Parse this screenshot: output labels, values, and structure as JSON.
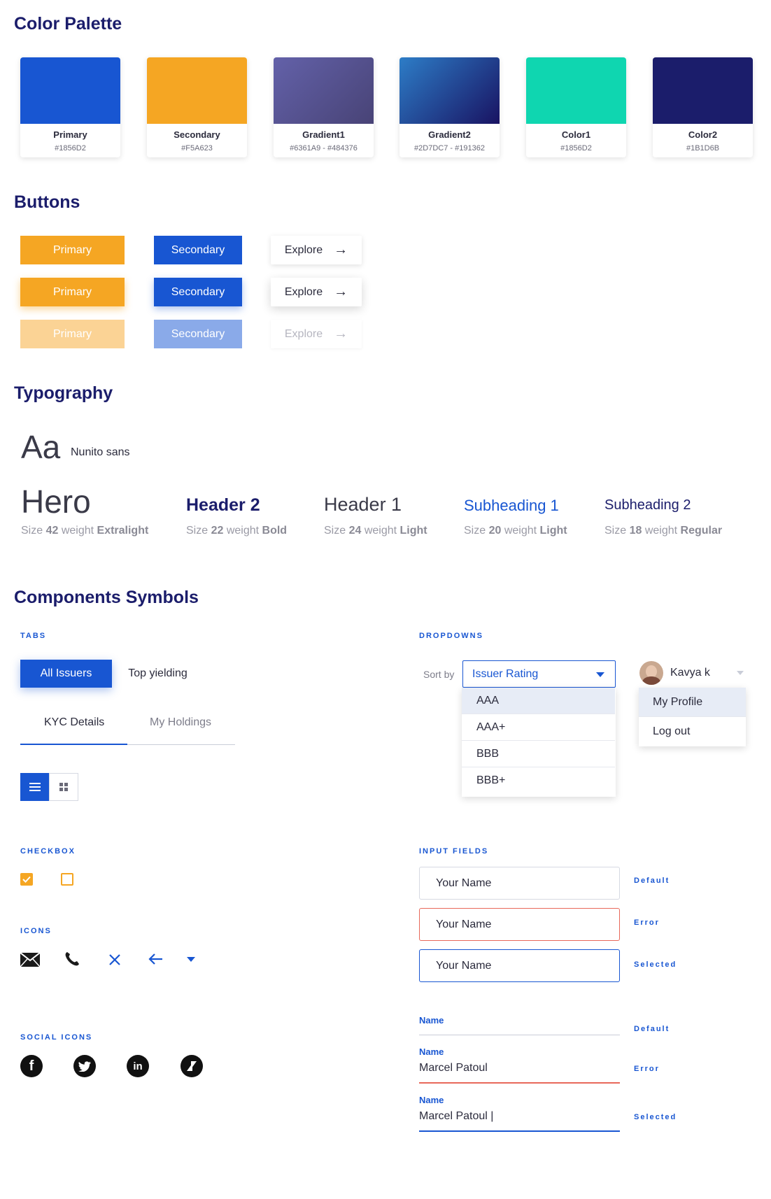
{
  "sections": {
    "palette": "Color Palette",
    "buttons": "Buttons",
    "typography": "Typography",
    "components": "Components Symbols"
  },
  "palette": [
    {
      "name": "Primary",
      "hex": "#1856D2",
      "color": "#1856d2"
    },
    {
      "name": "Secondary",
      "hex": "#F5A623",
      "color": "#f5a623"
    },
    {
      "name": "Gradient1",
      "hex": "#6361A9 - #484376",
      "color": "#6361a9",
      "color2": "#484376"
    },
    {
      "name": "Gradient2",
      "hex": "#2D7DC7 - #191362",
      "color": "#2d7dc7",
      "color2": "#191362"
    },
    {
      "name": "Color1",
      "hex": "#1856D2",
      "color": "#0fd6b0"
    },
    {
      "name": "Color2",
      "hex": "#1B1D6B",
      "color": "#1b1d6b"
    }
  ],
  "buttons": {
    "primary": "Primary",
    "secondary": "Secondary",
    "explore": "Explore",
    "arrow": "→"
  },
  "typography": {
    "aa": "Aa",
    "font": "Nunito sans",
    "samples": [
      {
        "text": "Hero",
        "caption_pre": "Size ",
        "caption_size": "42",
        "caption_mid": " weight ",
        "caption_weight": "Extralight"
      },
      {
        "text": "Header 2",
        "caption_pre": "Size ",
        "caption_size": "22",
        "caption_mid": " weight ",
        "caption_weight": "Bold"
      },
      {
        "text": "Header 1",
        "caption_pre": "Size ",
        "caption_size": "24",
        "caption_mid": " weight ",
        "caption_weight": "Light"
      },
      {
        "text": "Subheading 1",
        "caption_pre": "Size ",
        "caption_size": "20",
        "caption_mid": " weight ",
        "caption_weight": "Light"
      },
      {
        "text": "Subheading 2",
        "caption_pre": "Size ",
        "caption_size": "18",
        "caption_mid": " weight ",
        "caption_weight": "Regular"
      }
    ]
  },
  "tabs": {
    "label": "TABS",
    "pill_active": "All Issuers",
    "pill_inactive": "Top yielding",
    "under_active": "KYC Details",
    "under_inactive": "My Holdings"
  },
  "dropdowns": {
    "label": "DROPDOWNS",
    "sort_by": "Sort by",
    "selected": "Issuer Rating",
    "options": [
      "AAA",
      "AAA+",
      "BBB",
      "BBB+"
    ],
    "user_name": "Kavya k",
    "user_menu": [
      "My Profile",
      "Log out"
    ]
  },
  "checkbox": {
    "label": "CHECKBOX"
  },
  "icons": {
    "label": "ICONS"
  },
  "social": {
    "label": "SOCIAL ICONS",
    "facebook": "f",
    "linkedin": "in"
  },
  "inputs": {
    "label": "INPUT FIELDS",
    "placeholder": "Your Name",
    "states": [
      "Default",
      "Error",
      "Selected"
    ],
    "underline_label": "Name",
    "underline_values": [
      "",
      "Marcel Patoul",
      "Marcel Patoul |"
    ]
  }
}
